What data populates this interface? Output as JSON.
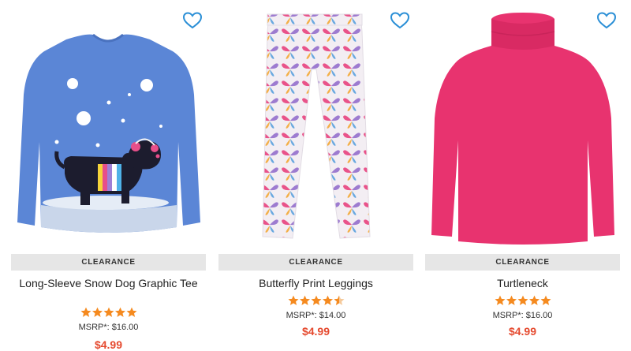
{
  "products": [
    {
      "badge": "CLEARANCE",
      "name": "Long-Sleeve Snow Dog Graphic Tee",
      "rating": 5,
      "msrp": "MSRP*: $16.00",
      "price": "$4.99",
      "image_icon": "snow-dog-tee-image",
      "color": "#5b86d6"
    },
    {
      "badge": "CLEARANCE",
      "name": "Butterfly Print Leggings",
      "rating": 4.5,
      "msrp": "MSRP*: $14.00",
      "price": "$4.99",
      "image_icon": "butterfly-leggings-image",
      "color": "#f2eef2"
    },
    {
      "badge": "CLEARANCE",
      "name": "Turtleneck",
      "rating": 5,
      "msrp": "MSRP*: $16.00",
      "price": "$4.99",
      "image_icon": "turtleneck-image",
      "color": "#e8336f"
    }
  ],
  "colors": {
    "heart": "#2b8fd6",
    "star": "#f58a1f",
    "price": "#e5492e",
    "badge_bg": "#e6e6e6"
  }
}
